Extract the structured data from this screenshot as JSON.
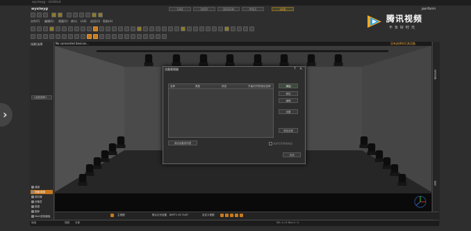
{
  "window": {
    "title": "wysiwyg - Untitled",
    "logo": "wysiwyg"
  },
  "brand": {
    "name": "腾讯视频",
    "tagline": "不负好时光"
  },
  "perform_label": "perform",
  "modes": [
    {
      "label": "CAD",
      "active": false
    },
    {
      "label": "DATA",
      "active": false
    },
    {
      "label": "DESIGN",
      "active": false
    },
    {
      "label": "PRES",
      "active": false
    },
    {
      "label": "LIVE",
      "active": true
    }
  ],
  "menu": [
    "文件(F)",
    "编辑(E)",
    "视图(V)",
    "库(L)",
    "LIVE",
    "选项(O)",
    "帮助(H)"
  ],
  "left_panel": {
    "title": "场景/选择",
    "combo_value": "<全部选择>",
    "items": [
      {
        "label": "通道",
        "selected": false
      },
      {
        "label": "场景/选择",
        "selected": true
      },
      {
        "label": "调光器",
        "selected": false
      },
      {
        "label": "设备层",
        "selected": false
      },
      {
        "label": "数据",
        "selected": false
      },
      {
        "label": "图库",
        "selected": false
      },
      {
        "label": "Multi控制面板",
        "selected": false
      }
    ]
  },
  "viewport": {
    "message": "No connected devices...",
    "right_label": "没有选择的灯具设备"
  },
  "dialog": {
    "title": "设备管理器",
    "columns": [
      "名称",
      "类型",
      "状态",
      "只读/打开的协议名称"
    ],
    "buttons_right": [
      "添加",
      "移除",
      "编辑",
      "设置",
      "添加全部"
    ],
    "bottom_left_button": "添加设备到列表",
    "checkbox_label": "允许打开所有协议",
    "close_button": "关闭"
  },
  "right_strip": {
    "labels": [
      "库浏览器",
      "属性"
    ]
  },
  "bottom_bar": {
    "items": [
      "主视图",
      "默认灯光设置",
      "BRFT1 95 TUXT",
      "自定义视图"
    ]
  },
  "status_bar": {
    "left": [
      "就绪",
      "视图",
      "对象"
    ],
    "right": "SEL 0 / 0 Dev 0 : 0"
  }
}
